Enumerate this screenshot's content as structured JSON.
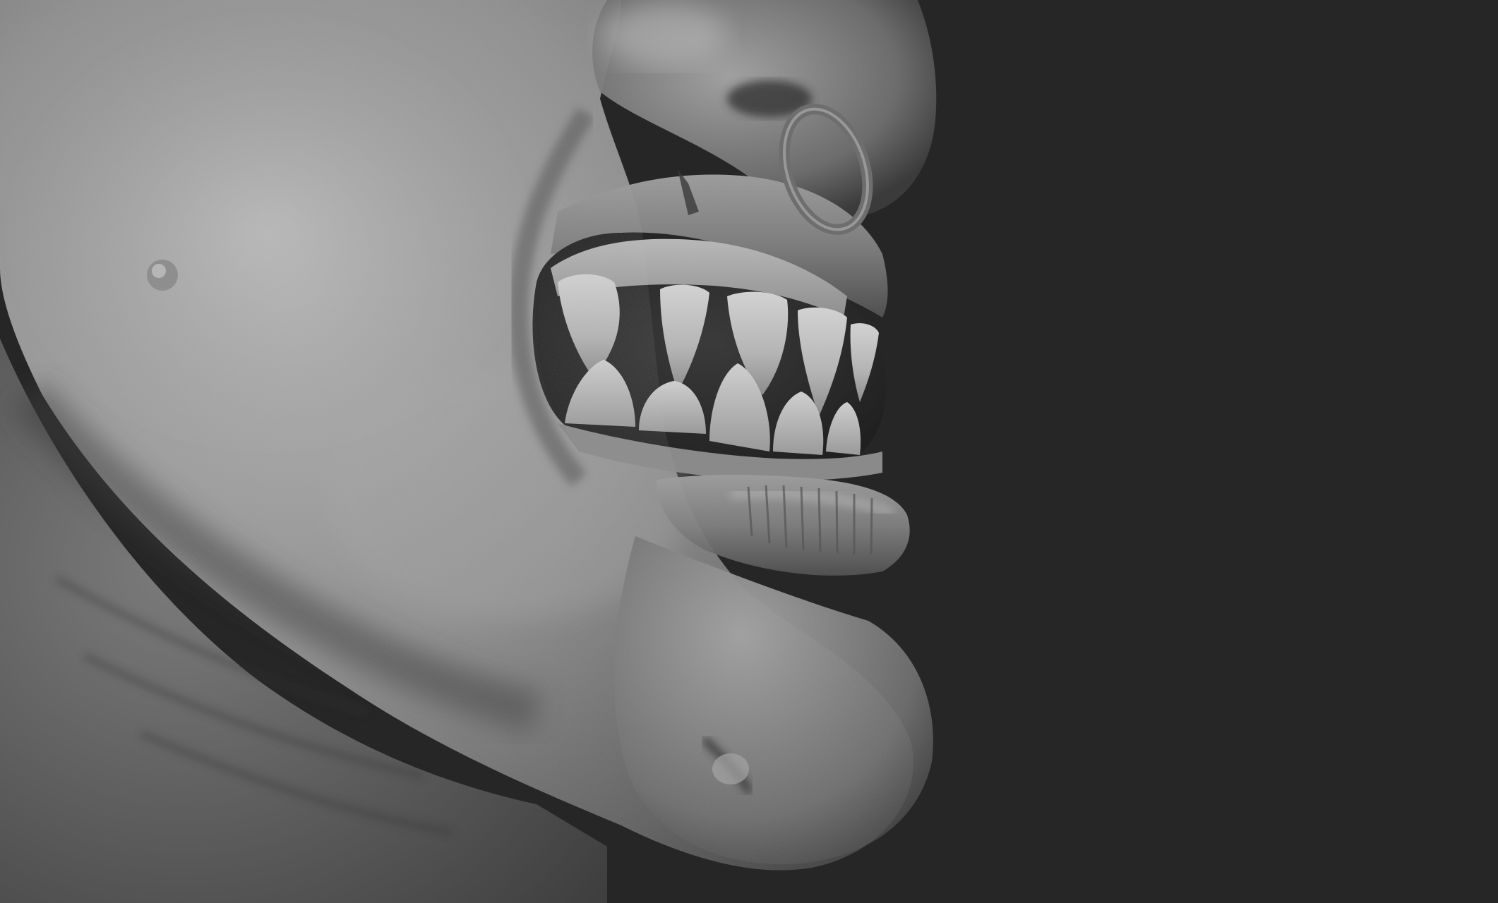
{
  "scene": {
    "subject": "sculpted-creature-head",
    "background_color": "#262626",
    "skin_light": "#a8a8a8",
    "skin_mid": "#7a7a7a",
    "skin_dark": "#3c3c3c",
    "tooth_color": "#b9b9b9",
    "mouth_interior_color": "#2b2b2b",
    "ring_color": "#6a6a6a"
  }
}
